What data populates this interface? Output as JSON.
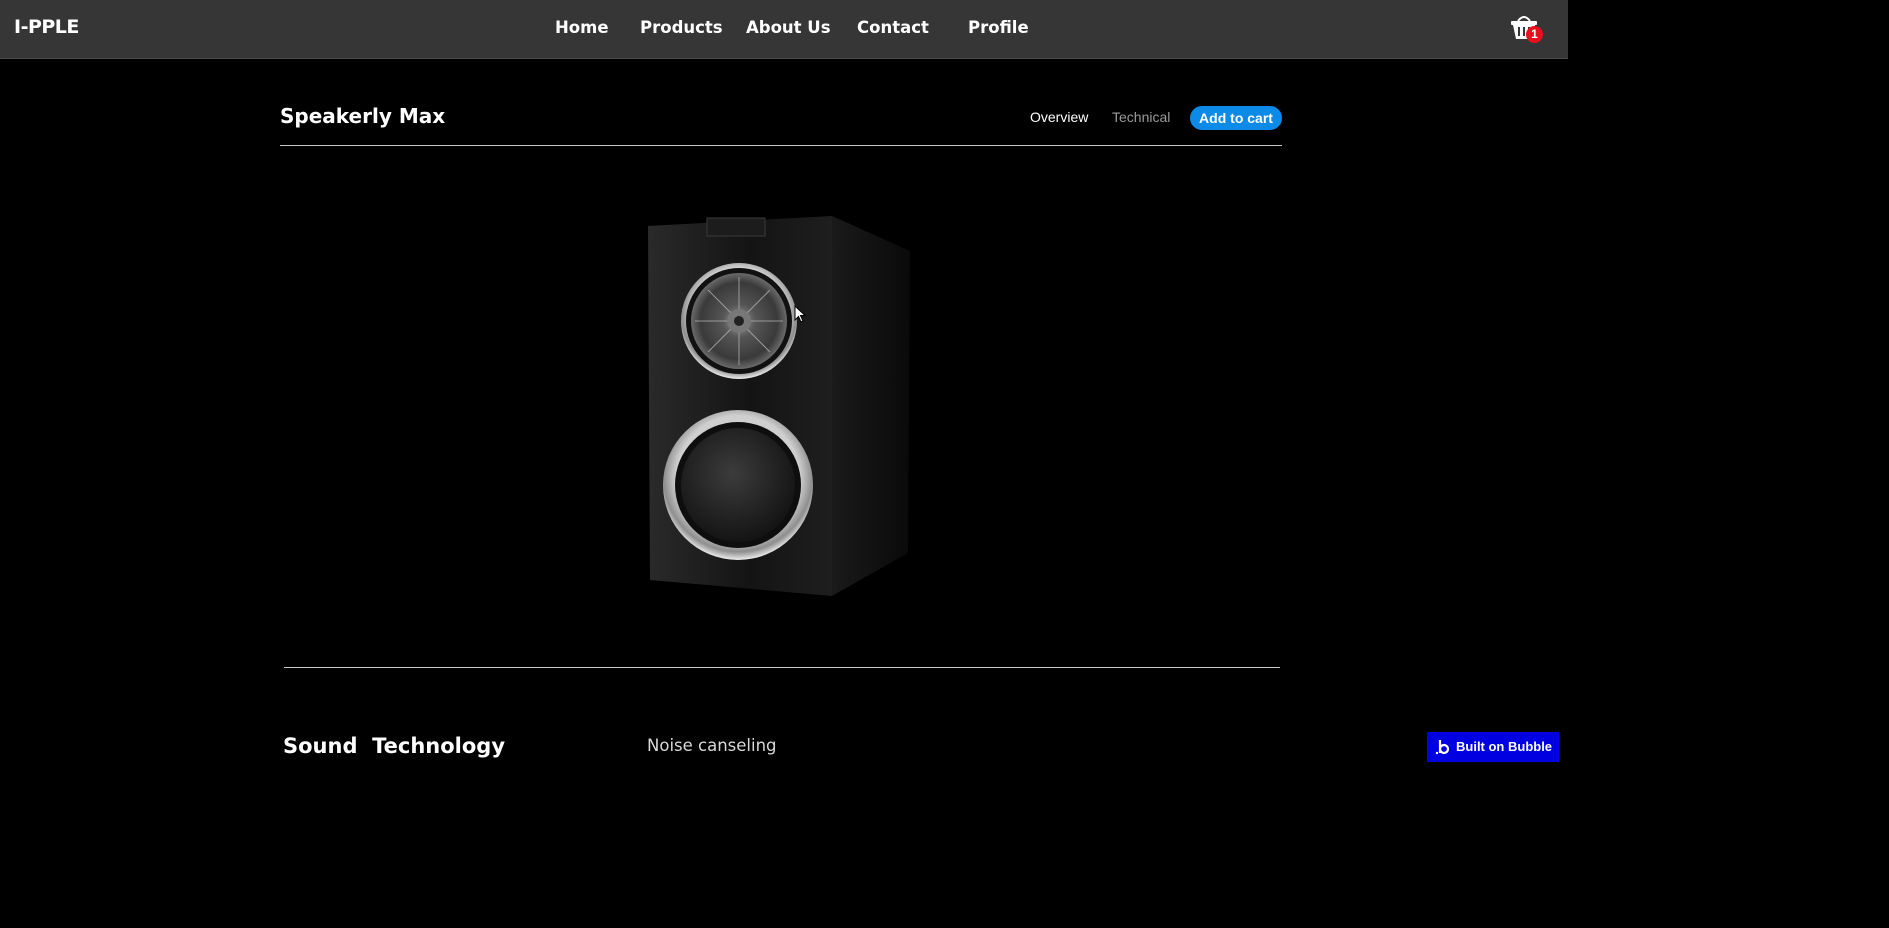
{
  "brand": {
    "logo_text": "I-PPLE"
  },
  "nav": {
    "items": [
      {
        "label": "Home"
      },
      {
        "label": "Products"
      },
      {
        "label": "About Us"
      },
      {
        "label": "Contact"
      },
      {
        "label": "Profile"
      }
    ]
  },
  "cart": {
    "icon": "shopping-basket-icon",
    "count": "1"
  },
  "product": {
    "title": "Speakerly Max",
    "image_icon": "bookshelf-speaker-image"
  },
  "tabs": {
    "overview": "Overview",
    "technical": "Technical"
  },
  "actions": {
    "add_to_cart": "Add to cart"
  },
  "section": {
    "title": "Sound  Technology",
    "feature": "Noise canseling"
  },
  "footer_badge": {
    "label": "Built on Bubble",
    "icon": "bubble-logo-icon"
  },
  "colors": {
    "navbar_bg": "#363636",
    "page_bg": "#000000",
    "accent": "#0b8ae8",
    "badge": "#e8101e",
    "bubble_badge": "#0000e0"
  }
}
